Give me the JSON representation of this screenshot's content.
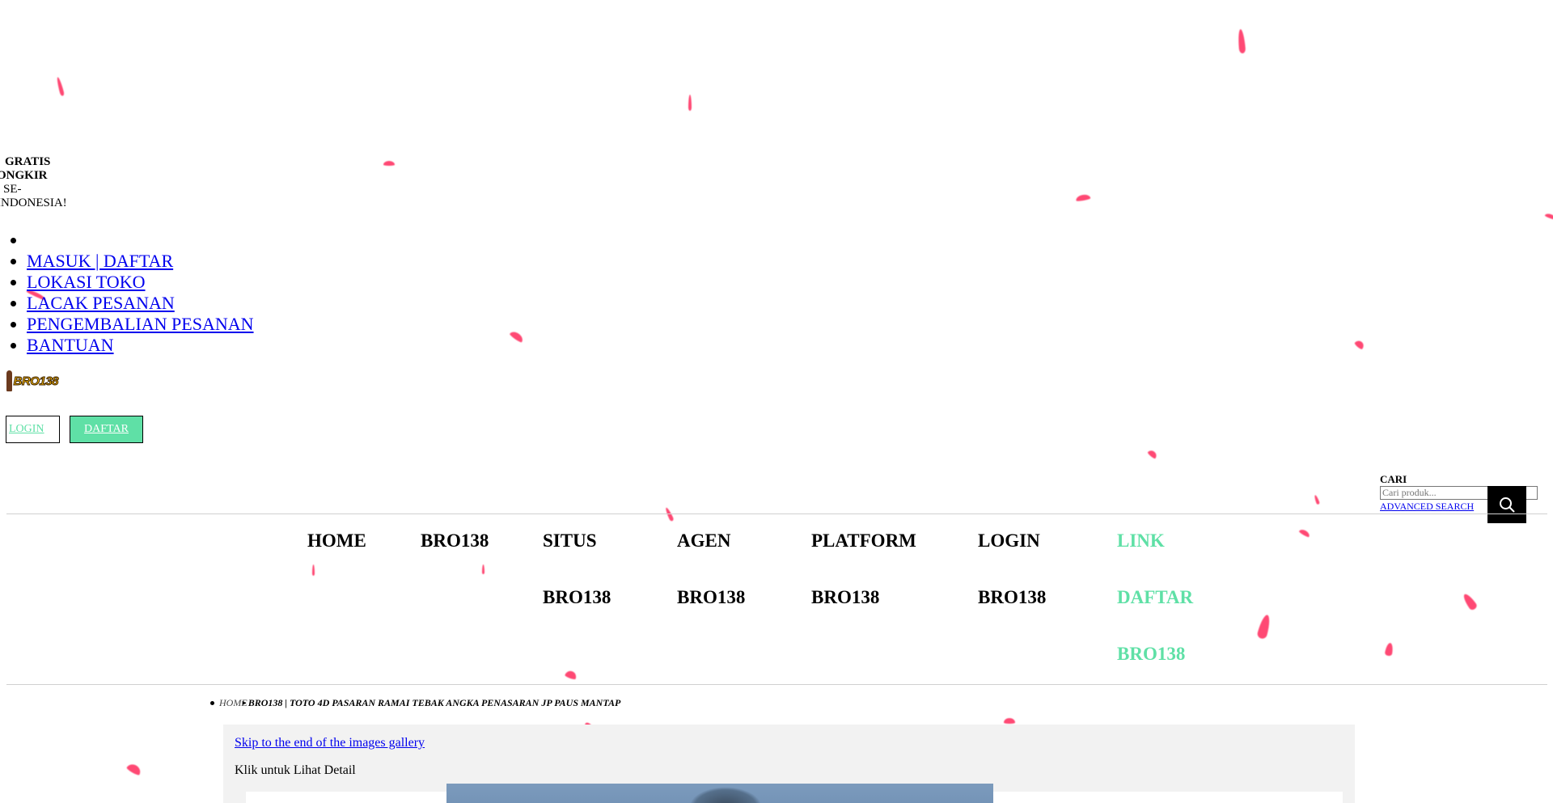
{
  "promo": {
    "line1": "GRATIS",
    "line2": "ONGKIR",
    "line3": "SE-",
    "line4": "INDONESIA!"
  },
  "topnav": {
    "items": [
      {
        "label": "MASUK | DAFTAR"
      },
      {
        "label": "LOKASI TOKO"
      },
      {
        "label": "LACAK PESANAN"
      },
      {
        "label": "PENGEMBALIAN PESANAN"
      },
      {
        "label": "BANTUAN"
      }
    ]
  },
  "logo": {
    "text": "BRO138"
  },
  "auth": {
    "login_label": "LOGIN",
    "daftar_label": "DAFTAR"
  },
  "search": {
    "label": "CARI",
    "placeholder": "Cari produk...",
    "advanced_label": "ADVANCED SEARCH",
    "icon": "search-icon"
  },
  "mainnav": {
    "home": "HOME",
    "bro138": "BRO138",
    "situs_1": "SITUS",
    "situs_2": "BRO138",
    "agen_1": "AGEN",
    "agen_2": "BRO138",
    "platform_1": "PLATFORM",
    "platform_2": "BRO138",
    "login_1": "LOGIN",
    "login_2": "BRO138",
    "link_1": "LINK",
    "link_2": "DAFTAR",
    "link_3": "BRO138"
  },
  "breadcrumb": {
    "home": "HOME",
    "current": "BRO138 | TOTO 4D PASARAN RAMAI TEBAK ANGKA PENASARAN JP PAUS MANTAP"
  },
  "gallery": {
    "skip_label": "Skip to the end of the images gallery",
    "hint": "Klik untuk Lihat Detail"
  },
  "colors": {
    "accent_green": "#5fe0a6",
    "petal_red": "#ff2a5c",
    "link_blue": "#0000ee"
  }
}
